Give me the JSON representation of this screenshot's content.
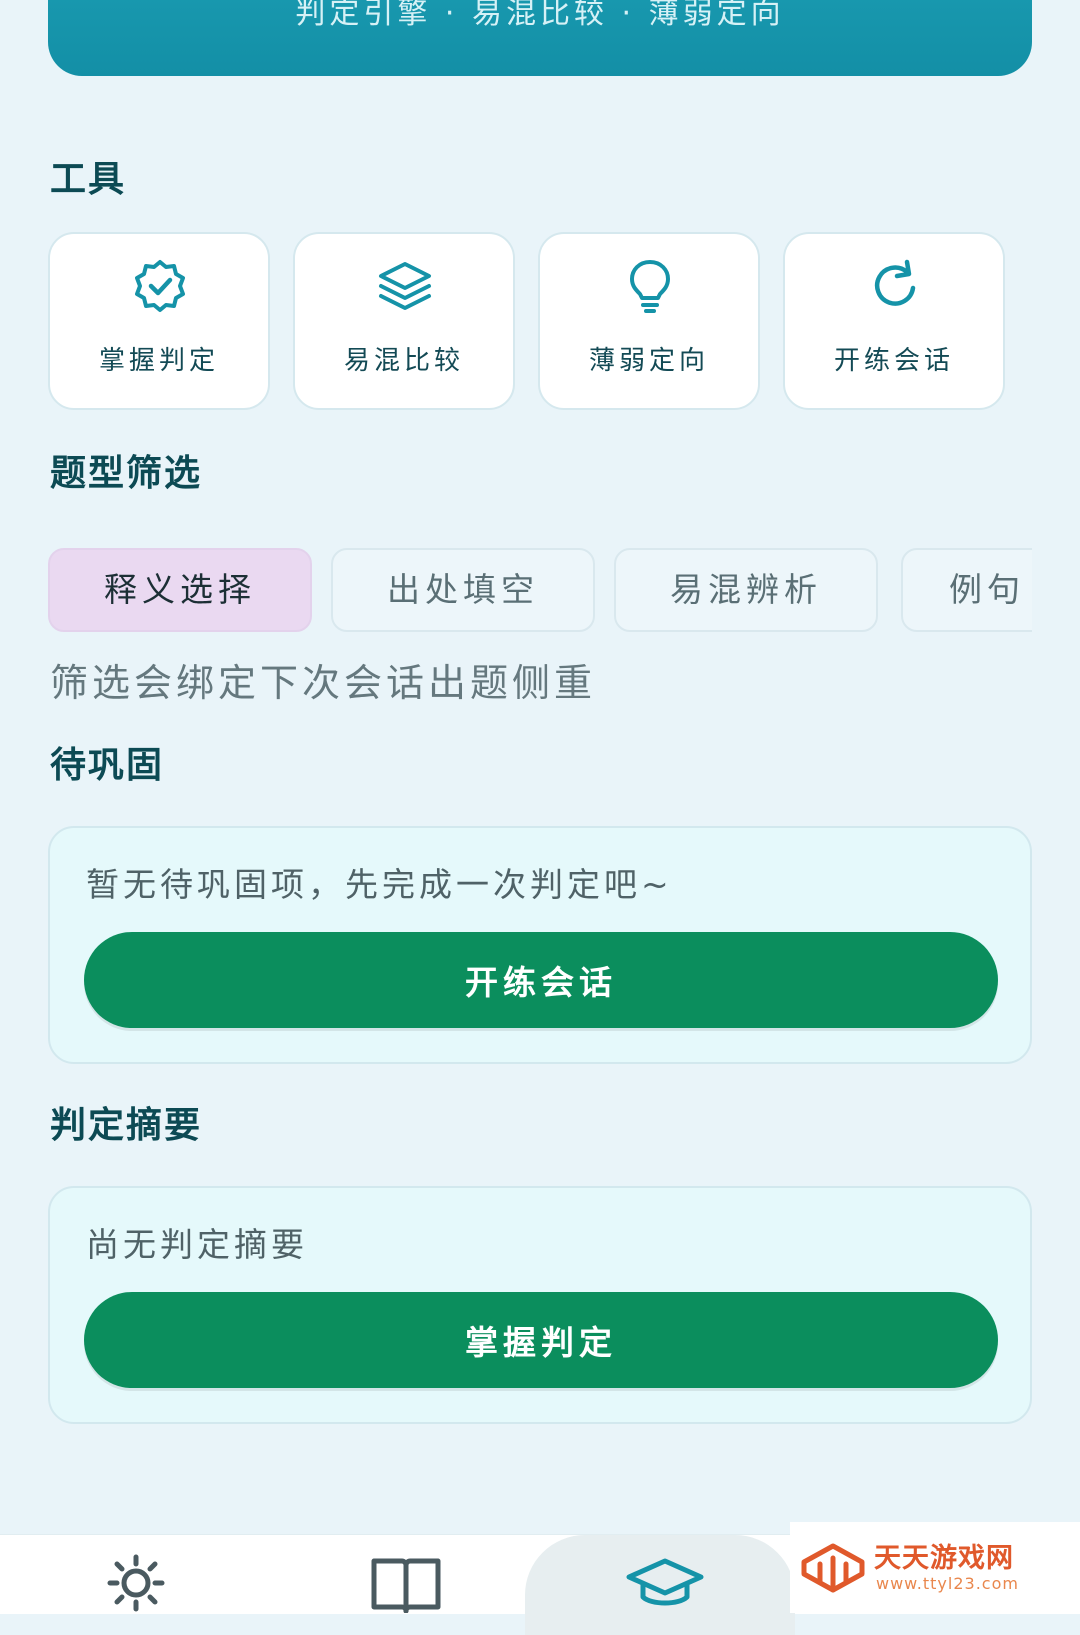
{
  "banner": {
    "text": "判定引擎 · 易混比较 · 薄弱定向"
  },
  "tools": {
    "title": "工具",
    "items": [
      {
        "label": "掌握判定",
        "icon": "verified-badge-icon"
      },
      {
        "label": "易混比较",
        "icon": "layers-icon"
      },
      {
        "label": "薄弱定向",
        "icon": "lightbulb-icon"
      },
      {
        "label": "开练会话",
        "icon": "refresh-icon"
      }
    ]
  },
  "filter": {
    "title": "题型筛选",
    "chips": [
      {
        "label": "释义选择",
        "active": true
      },
      {
        "label": "出处填空",
        "active": false
      },
      {
        "label": "易混辨析",
        "active": false
      },
      {
        "label": "例句",
        "active": false
      }
    ],
    "hint": "筛选会绑定下次会话出题侧重"
  },
  "pending": {
    "title": "待巩固",
    "empty_text": "暂无待巩固项，先完成一次判定吧~",
    "button_label": "开练会话"
  },
  "summary": {
    "title": "判定摘要",
    "empty_text": "尚无判定摘要",
    "button_label": "掌握判定"
  },
  "bottom_nav": {
    "items": [
      {
        "icon": "sun-icon"
      },
      {
        "icon": "book-icon"
      },
      {
        "icon": "graduation-cap-icon",
        "active": true
      }
    ]
  },
  "watermark": {
    "title": "天天游戏网",
    "url": "www.ttyl23.com"
  },
  "colors": {
    "accent_teal": "#138fa6",
    "primary_green": "#0b8e5d",
    "active_chip": "#ead9f1",
    "background": "#e9f4f9"
  }
}
